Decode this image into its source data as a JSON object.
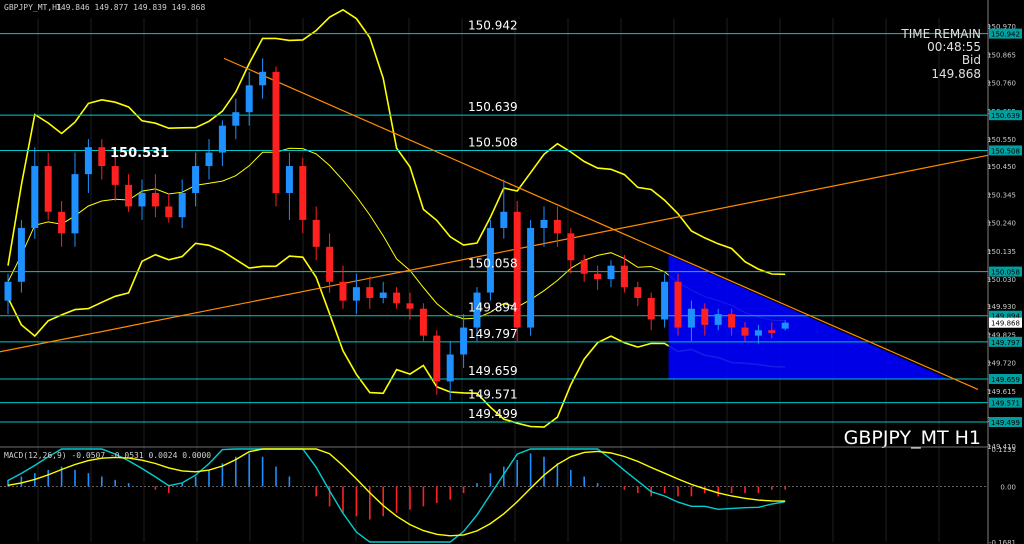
{
  "header": {
    "symbol_info": "GBPJPY_MT,H1",
    "ohlc": "149.846 149.877 149.839 149.868"
  },
  "overlay": {
    "time_remain_label": "TIME REMAIN",
    "time_remain_value": "00:48:55",
    "bid_label": "Bid",
    "bid_value": "149.868",
    "watermark": "GBPJPY_MT H1"
  },
  "macd_header": "MACD(12,26,9) -0.0507 -0.0531 0.0024 0.0000",
  "colors": {
    "background": "#000000",
    "bull": "#1e90ff",
    "bear": "#ff2020",
    "bollinger": "#ffff00",
    "level_line": "#00c8c8",
    "trend_line": "#ff8c00",
    "triangle": "#0000ff",
    "macd_line": "#00ced1",
    "signal_line": "#ffff00"
  },
  "chart_data": [
    {
      "type": "candlestick",
      "symbol": "GBPJPY_MT",
      "timeframe": "H1",
      "ylim": [
        149.41,
        151.0
      ],
      "price_axis_ticks": [
        150.97,
        150.865,
        150.76,
        150.655,
        150.55,
        150.45,
        150.345,
        150.24,
        150.135,
        150.03,
        149.93,
        149.825,
        149.72,
        149.615,
        149.51,
        149.41
      ],
      "price_axis_tick_labels": [
        "150.970",
        "150.865",
        "150.760",
        "150.655",
        "150.550",
        "150.450",
        "150.345",
        "150.240",
        "150.135",
        "150.030",
        "149.930",
        "149.825",
        "149.720",
        "149.615",
        "149.510",
        "149.410"
      ],
      "horizontal_levels": [
        150.942,
        150.639,
        150.508,
        150.058,
        149.894,
        149.797,
        149.659,
        149.571,
        149.499
      ],
      "horizontal_level_labels": [
        "150.942",
        "150.639",
        "150.508",
        "150.058",
        "149.894",
        "149.797",
        "149.659",
        "149.571",
        "149.499"
      ],
      "price_tags": [
        {
          "value": 150.942,
          "label": "150.942"
        },
        {
          "value": 150.639,
          "label": "150.639"
        },
        {
          "value": 150.508,
          "label": "150.508"
        },
        {
          "value": 150.058,
          "label": "150.058"
        },
        {
          "value": 149.894,
          "label": "149.894"
        },
        {
          "value": 149.868,
          "label": "149.868"
        },
        {
          "value": 149.797,
          "label": "149.797"
        },
        {
          "value": 149.659,
          "label": "149.659"
        },
        {
          "value": 149.571,
          "label": "149.571"
        },
        {
          "value": 149.499,
          "label": "149.499"
        }
      ],
      "annotation": {
        "label": "150.531",
        "value": 150.531
      },
      "candles": [
        [
          149.95,
          150.05,
          149.9,
          150.02
        ],
        [
          150.02,
          150.25,
          149.98,
          150.22
        ],
        [
          150.22,
          150.52,
          150.18,
          150.45
        ],
        [
          150.45,
          150.5,
          150.25,
          150.28
        ],
        [
          150.28,
          150.32,
          150.15,
          150.2
        ],
        [
          150.2,
          150.5,
          150.15,
          150.42
        ],
        [
          150.42,
          150.55,
          150.35,
          150.52
        ],
        [
          150.52,
          150.55,
          150.4,
          150.45
        ],
        [
          150.45,
          150.5,
          150.32,
          150.38
        ],
        [
          150.38,
          150.42,
          150.28,
          150.3
        ],
        [
          150.3,
          150.4,
          150.25,
          150.35
        ],
        [
          150.35,
          150.42,
          150.26,
          150.3
        ],
        [
          150.3,
          150.35,
          150.24,
          150.26
        ],
        [
          150.26,
          150.4,
          150.22,
          150.35
        ],
        [
          150.35,
          150.5,
          150.3,
          150.45
        ],
        [
          150.45,
          150.55,
          150.4,
          150.5
        ],
        [
          150.5,
          150.62,
          150.45,
          150.6
        ],
        [
          150.6,
          150.7,
          150.55,
          150.65
        ],
        [
          150.65,
          150.8,
          150.6,
          150.75
        ],
        [
          150.75,
          150.85,
          150.7,
          150.8
        ],
        [
          150.8,
          150.82,
          150.3,
          150.35
        ],
        [
          150.35,
          150.5,
          150.25,
          150.45
        ],
        [
          150.45,
          150.48,
          150.2,
          150.25
        ],
        [
          150.25,
          150.3,
          150.1,
          150.15
        ],
        [
          150.15,
          150.2,
          149.98,
          150.02
        ],
        [
          150.02,
          150.08,
          149.92,
          149.95
        ],
        [
          149.95,
          150.05,
          149.9,
          150.0
        ],
        [
          150.0,
          150.04,
          149.92,
          149.96
        ],
        [
          149.96,
          150.02,
          149.94,
          149.98
        ],
        [
          149.98,
          150.0,
          149.92,
          149.94
        ],
        [
          149.94,
          149.98,
          149.88,
          149.92
        ],
        [
          149.92,
          149.94,
          149.8,
          149.82
        ],
        [
          149.82,
          149.84,
          149.6,
          149.65
        ],
        [
          149.65,
          149.8,
          149.58,
          149.75
        ],
        [
          149.75,
          149.9,
          149.7,
          149.85
        ],
        [
          149.85,
          150.0,
          149.8,
          149.98
        ],
        [
          149.98,
          150.25,
          149.95,
          150.22
        ],
        [
          150.22,
          150.4,
          150.18,
          150.28
        ],
        [
          150.28,
          150.32,
          149.8,
          149.85
        ],
        [
          149.85,
          150.25,
          149.82,
          150.22
        ],
        [
          150.22,
          150.3,
          150.15,
          150.25
        ],
        [
          150.25,
          150.3,
          150.15,
          150.2
        ],
        [
          150.2,
          150.22,
          150.05,
          150.1
        ],
        [
          150.1,
          150.12,
          150.02,
          150.05
        ],
        [
          150.05,
          150.08,
          149.99,
          150.03
        ],
        [
          150.03,
          150.1,
          150.0,
          150.08
        ],
        [
          150.08,
          150.12,
          149.98,
          150.0
        ],
        [
          150.0,
          150.02,
          149.93,
          149.96
        ],
        [
          149.96,
          149.98,
          149.84,
          149.88
        ],
        [
          149.88,
          150.05,
          149.85,
          150.02
        ],
        [
          150.02,
          150.05,
          149.82,
          149.85
        ],
        [
          149.85,
          149.95,
          149.8,
          149.92
        ],
        [
          149.92,
          149.94,
          149.82,
          149.86
        ],
        [
          149.86,
          149.92,
          149.84,
          149.9
        ],
        [
          149.9,
          149.92,
          149.82,
          149.85
        ],
        [
          149.85,
          149.87,
          149.8,
          149.82
        ],
        [
          149.82,
          149.86,
          149.79,
          149.84
        ],
        [
          149.84,
          149.87,
          149.81,
          149.83
        ],
        [
          149.846,
          149.877,
          149.839,
          149.868
        ]
      ],
      "triangle": {
        "from_price": 150.12,
        "to_price": 149.66
      }
    },
    {
      "type": "bar",
      "name": "MACD(12,26,9)",
      "values_header": [
        "-0.0507",
        "-0.0531",
        "0.0024",
        "0.0000"
      ],
      "ylim": [
        -0.1681,
        0.1133
      ],
      "axis_ticks": [
        0.1133,
        0.0,
        -0.1681
      ],
      "axis_tick_labels": [
        "0.1133",
        "0.00",
        "-0.1681"
      ],
      "histogram": [
        0.02,
        0.03,
        0.04,
        0.05,
        0.06,
        0.05,
        0.04,
        0.03,
        0.02,
        0.01,
        0.0,
        -0.01,
        -0.02,
        0.01,
        0.03,
        0.05,
        0.07,
        0.09,
        0.1,
        0.09,
        0.06,
        0.03,
        0.0,
        -0.03,
        -0.06,
        -0.08,
        -0.09,
        -0.1,
        -0.09,
        -0.08,
        -0.07,
        -0.06,
        -0.05,
        -0.04,
        -0.02,
        0.01,
        0.04,
        0.06,
        0.08,
        0.1,
        0.09,
        0.07,
        0.05,
        0.03,
        0.01,
        0.0,
        -0.01,
        -0.02,
        -0.03,
        -0.02,
        -0.03,
        -0.03,
        -0.02,
        -0.03,
        -0.02,
        -0.02,
        -0.02,
        -0.01,
        -0.01
      ]
    }
  ]
}
